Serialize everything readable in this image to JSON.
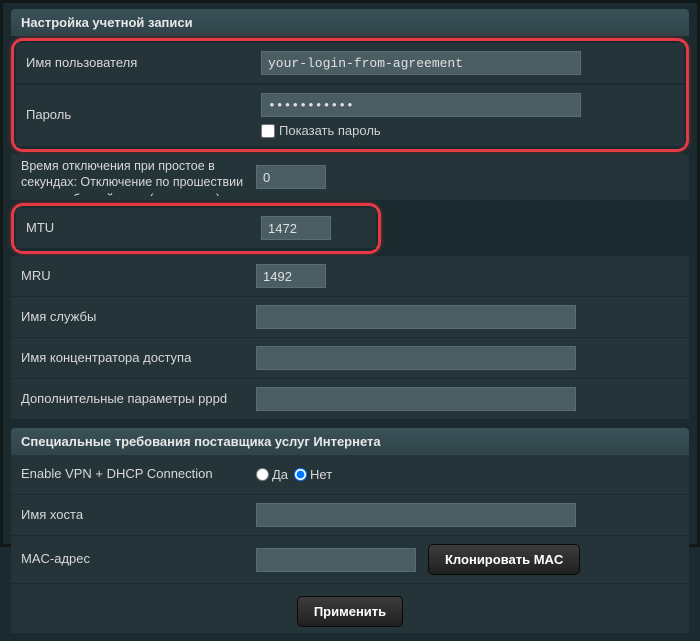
{
  "section1": {
    "title": "Настройка учетной записи"
  },
  "account": {
    "username_label": "Имя пользователя",
    "username_value": "your-login-from-agreement",
    "password_label": "Пароль",
    "password_value": "•••••••••••",
    "show_password_label": "Показать пароль"
  },
  "timeout": {
    "label": "Время отключения при простое в секундах: Отключение по прошествии периода бездействия (в секундах)",
    "value": "0"
  },
  "mtu": {
    "label": "MTU",
    "value": "1472"
  },
  "mru": {
    "label": "MRU",
    "value": "1492"
  },
  "service": {
    "label": "Имя службы",
    "value": ""
  },
  "concentrator": {
    "label": "Имя концентратора доступа",
    "value": ""
  },
  "pppd": {
    "label": "Дополнительные параметры pppd",
    "value": ""
  },
  "section2": {
    "title": "Специальные требования поставщика услуг Интернета"
  },
  "vpn": {
    "label": "Enable VPN + DHCP Connection",
    "yes": "Да",
    "no": "Нет"
  },
  "hostname": {
    "label": "Имя хоста",
    "value": ""
  },
  "mac": {
    "label": "MAC-адрес",
    "value": "",
    "clone_btn": "Клонировать MAC"
  },
  "apply": {
    "label": "Применить"
  }
}
